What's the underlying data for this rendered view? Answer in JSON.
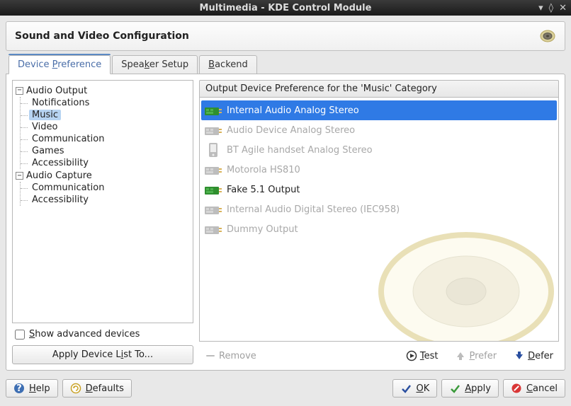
{
  "window_title": "Multimedia - KDE Control Module",
  "page_title": "Sound and Video Configuration",
  "tabs": [
    {
      "label": "Device Preference",
      "accel_index": 7,
      "active": true
    },
    {
      "label": "Speaker Setup",
      "accel_index": 4,
      "active": false
    },
    {
      "label": "Backend",
      "accel_index": 0,
      "active": false
    }
  ],
  "tree": {
    "output_label": "Audio Output",
    "output_expanded": false,
    "output_children": [
      {
        "label": "Notifications",
        "selected": false
      },
      {
        "label": "Music",
        "selected": true
      },
      {
        "label": "Video",
        "selected": false
      },
      {
        "label": "Communication",
        "selected": false
      },
      {
        "label": "Games",
        "selected": false
      },
      {
        "label": "Accessibility",
        "selected": false
      }
    ],
    "capture_label": "Audio Capture",
    "capture_expanded": false,
    "capture_children": [
      {
        "label": "Communication",
        "selected": false
      },
      {
        "label": "Accessibility",
        "selected": false
      }
    ]
  },
  "left_controls": {
    "show_advanced_label": "Show advanced devices",
    "show_advanced_accel": 0,
    "show_advanced_checked": false,
    "apply_list_label": "Apply Device List To...",
    "apply_list_accel": 14
  },
  "device_list": {
    "header": "Output Device Preference for the 'Music' Category",
    "items": [
      {
        "label": "Internal Audio Analog Stereo",
        "selected": true,
        "disabled": false,
        "icon": "pcb"
      },
      {
        "label": "Audio Device Analog Stereo",
        "selected": false,
        "disabled": true,
        "icon": "pcb"
      },
      {
        "label": "BT Agile handset Analog Stereo",
        "selected": false,
        "disabled": true,
        "icon": "phone"
      },
      {
        "label": "Motorola HS810",
        "selected": false,
        "disabled": true,
        "icon": "pcb"
      },
      {
        "label": "Fake 5.1 Output",
        "selected": false,
        "disabled": false,
        "icon": "pcb"
      },
      {
        "label": "Internal Audio Digital Stereo (IEC958)",
        "selected": false,
        "disabled": true,
        "icon": "pcb"
      },
      {
        "label": "Dummy Output",
        "selected": false,
        "disabled": true,
        "icon": "pcb"
      }
    ]
  },
  "device_buttons": {
    "remove_label": "Remove",
    "remove_accel": null,
    "remove_enabled": false,
    "test_label": "Test",
    "test_accel": 0,
    "prefer_label": "Prefer",
    "prefer_accel": 0,
    "prefer_enabled": false,
    "defer_label": "Defer",
    "defer_accel": 0
  },
  "footer": {
    "help_label": "Help",
    "help_accel": 0,
    "defaults_label": "Defaults",
    "defaults_accel": 0,
    "ok_label": "OK",
    "ok_accel": 0,
    "apply_label": "Apply",
    "apply_accel": 0,
    "cancel_label": "Cancel",
    "cancel_accel": 0
  }
}
